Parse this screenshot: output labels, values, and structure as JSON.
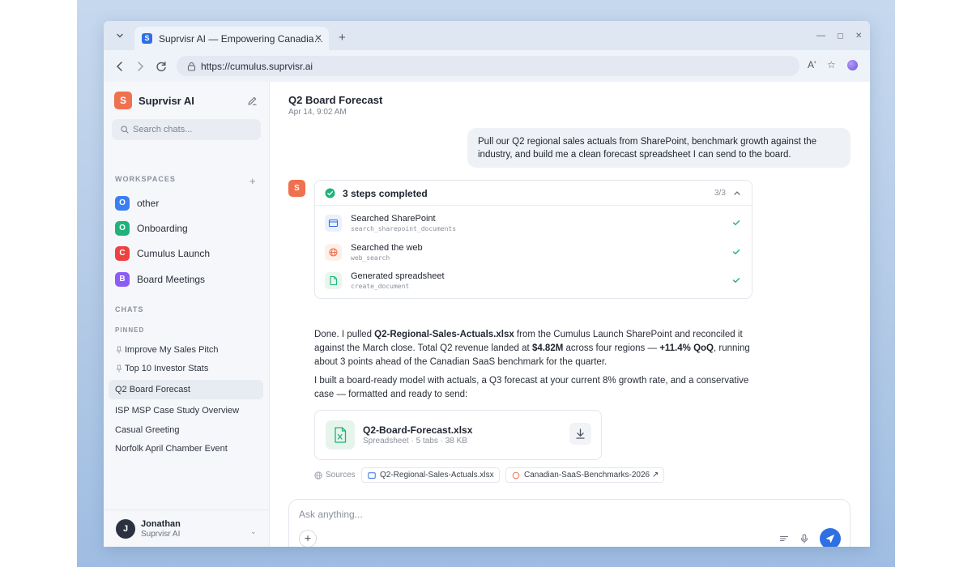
{
  "browser": {
    "tab_title": "Suprvisr AI — Empowering Canadia…",
    "tab_favicon": "S",
    "url": "https://cumulus.suprvisr.ai",
    "window_controls": [
      "—",
      "▢",
      "✕"
    ],
    "new_tab": "+",
    "tab_close": "✕",
    "reader_icon": "A'",
    "bookmark_icon": "☆"
  },
  "sidebar": {
    "brand_initial": "S",
    "brand_name": "Suprvisr AI",
    "search_placeholder": "Search chats...",
    "workspaces_label": "WORKSPACES",
    "add_label": "+",
    "workspaces": [
      {
        "initial": "O",
        "label": "other",
        "color": "#3b7ff0"
      },
      {
        "initial": "O",
        "label": "Onboarding",
        "color": "#1fb37a"
      },
      {
        "initial": "C",
        "label": "Cumulus Launch",
        "color": "#ec4341"
      },
      {
        "initial": "B",
        "label": "Board Meetings",
        "color": "#8b5cf6"
      }
    ],
    "chats_label": "CHATS",
    "pinned_label": "PINNED",
    "pinned_chats": [
      "Improve My Sales Pitch",
      "Top 10 Investor Stats"
    ],
    "chats": [
      "Q2 Board Forecast",
      "ISP MSP Case Study Overview",
      "Casual Greeting",
      "Norfolk April Chamber Event"
    ],
    "user": {
      "initial": "J",
      "name": "Jonathan",
      "org": "Suprvisr AI",
      "chevron": "⌄"
    }
  },
  "main": {
    "title": "Q2 Board Forecast",
    "timestamp": "Apr 14, 9:02 AM",
    "user_message": "Pull our Q2 regional sales actuals from SharePoint, benchmark growth against the industry, and build me a clean forecast spreadsheet I can send to the board.",
    "ai_initial": "S",
    "steps": {
      "title": "3 steps completed",
      "count": "3/3",
      "items": [
        {
          "name": "Searched SharePoint",
          "tool": "search_sharepoint_documents",
          "icon": "document-window-icon"
        },
        {
          "name": "Searched the web",
          "tool": "web_search",
          "icon": "globe-icon"
        },
        {
          "name": "Generated spreadsheet",
          "tool": "create_document",
          "icon": "file-icon"
        }
      ]
    },
    "reply_1": {
      "a": "Done. I pulled ",
      "b": "Q2-Regional-Sales-Actuals.xlsx",
      "c": " from the Cumulus Launch SharePoint and reconciled it against the March close. Total Q2 revenue landed at ",
      "d": "$4.82M",
      "e": " across four regions — ",
      "f": "+11.4% QoQ",
      "g": ", running about 3 points ahead of the Canadian SaaS benchmark for the quarter."
    },
    "reply_2": "I built a board-ready model with actuals, a Q3 forecast at your current 8% growth rate, and a conservative case — formatted and ready to send:",
    "file": {
      "name": "Q2-Board-Forecast.xlsx",
      "meta": "Spreadsheet · 5 tabs · 38 KB"
    },
    "sources_label": "Sources",
    "sources": [
      "Q2-Regional-Sales-Actuals.xlsx",
      "Canadian-SaaS-Benchmarks-2026 ↗"
    ],
    "composer_placeholder": "Ask anything...",
    "attach_label": "+"
  },
  "colors": {
    "accent": "#2f6fe4",
    "brand": "#f0714f",
    "success": "#1fb37a"
  }
}
